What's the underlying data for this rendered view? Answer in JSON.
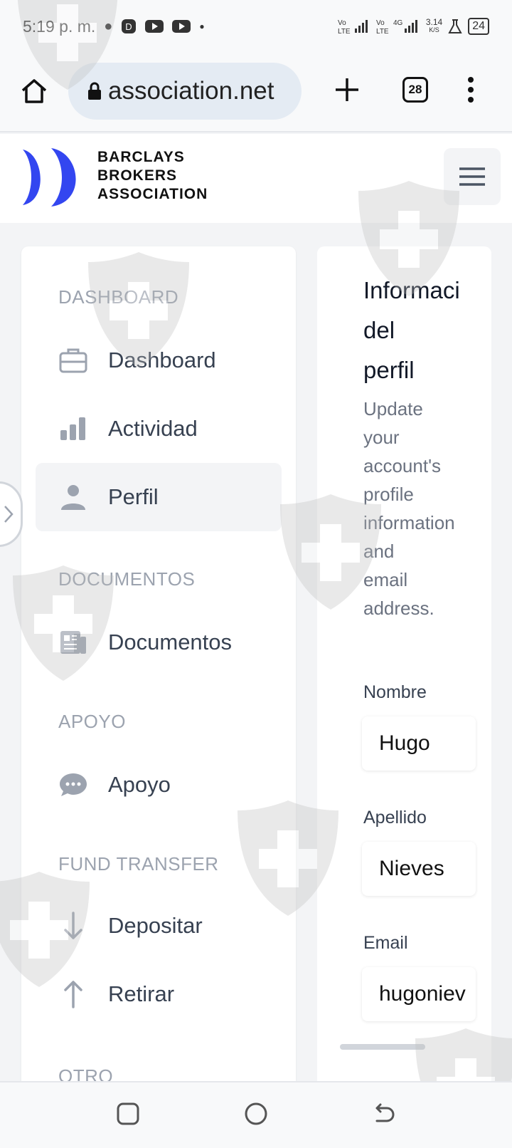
{
  "status_bar": {
    "time": "5:19 p. m.",
    "network_speed": "3.14",
    "network_speed_unit": "K/S",
    "battery": "24"
  },
  "browser": {
    "url": "association.net",
    "tab_count": "28"
  },
  "site": {
    "logo_line1": "BARCLAYS",
    "logo_line2": "BROKERS",
    "logo_line3": "ASSOCIATION",
    "brand_color": "#3346f0"
  },
  "sidebar": {
    "sections": {
      "dashboard": "DASHBOARD",
      "documents": "DOCUMENTOS",
      "support": "APOYO",
      "fund_transfer": "FUND TRANSFER",
      "other": "OTRO"
    },
    "items": [
      {
        "label": "Dashboard",
        "icon": "briefcase-icon"
      },
      {
        "label": "Actividad",
        "icon": "bar-chart-icon"
      },
      {
        "label": "Perfil",
        "icon": "user-icon",
        "active": true
      },
      {
        "label": "Documentos",
        "icon": "newspaper-icon"
      },
      {
        "label": "Apoyo",
        "icon": "chat-bubble-icon"
      },
      {
        "label": "Depositar",
        "icon": "arrow-down-icon"
      },
      {
        "label": "Retirar",
        "icon": "arrow-up-icon"
      }
    ]
  },
  "profile": {
    "title_line1": "Informaci",
    "title_line2": "del",
    "title_line3": "perfil",
    "desc_lines": [
      "Update",
      "your",
      "account's",
      "profile",
      "information",
      "and",
      "email",
      "address."
    ],
    "fields": {
      "first_name_label": "Nombre",
      "first_name_value": "Hugo",
      "last_name_label": "Apellido",
      "last_name_value": "Nieves",
      "email_label": "Email",
      "email_value": "hugoniev"
    }
  }
}
